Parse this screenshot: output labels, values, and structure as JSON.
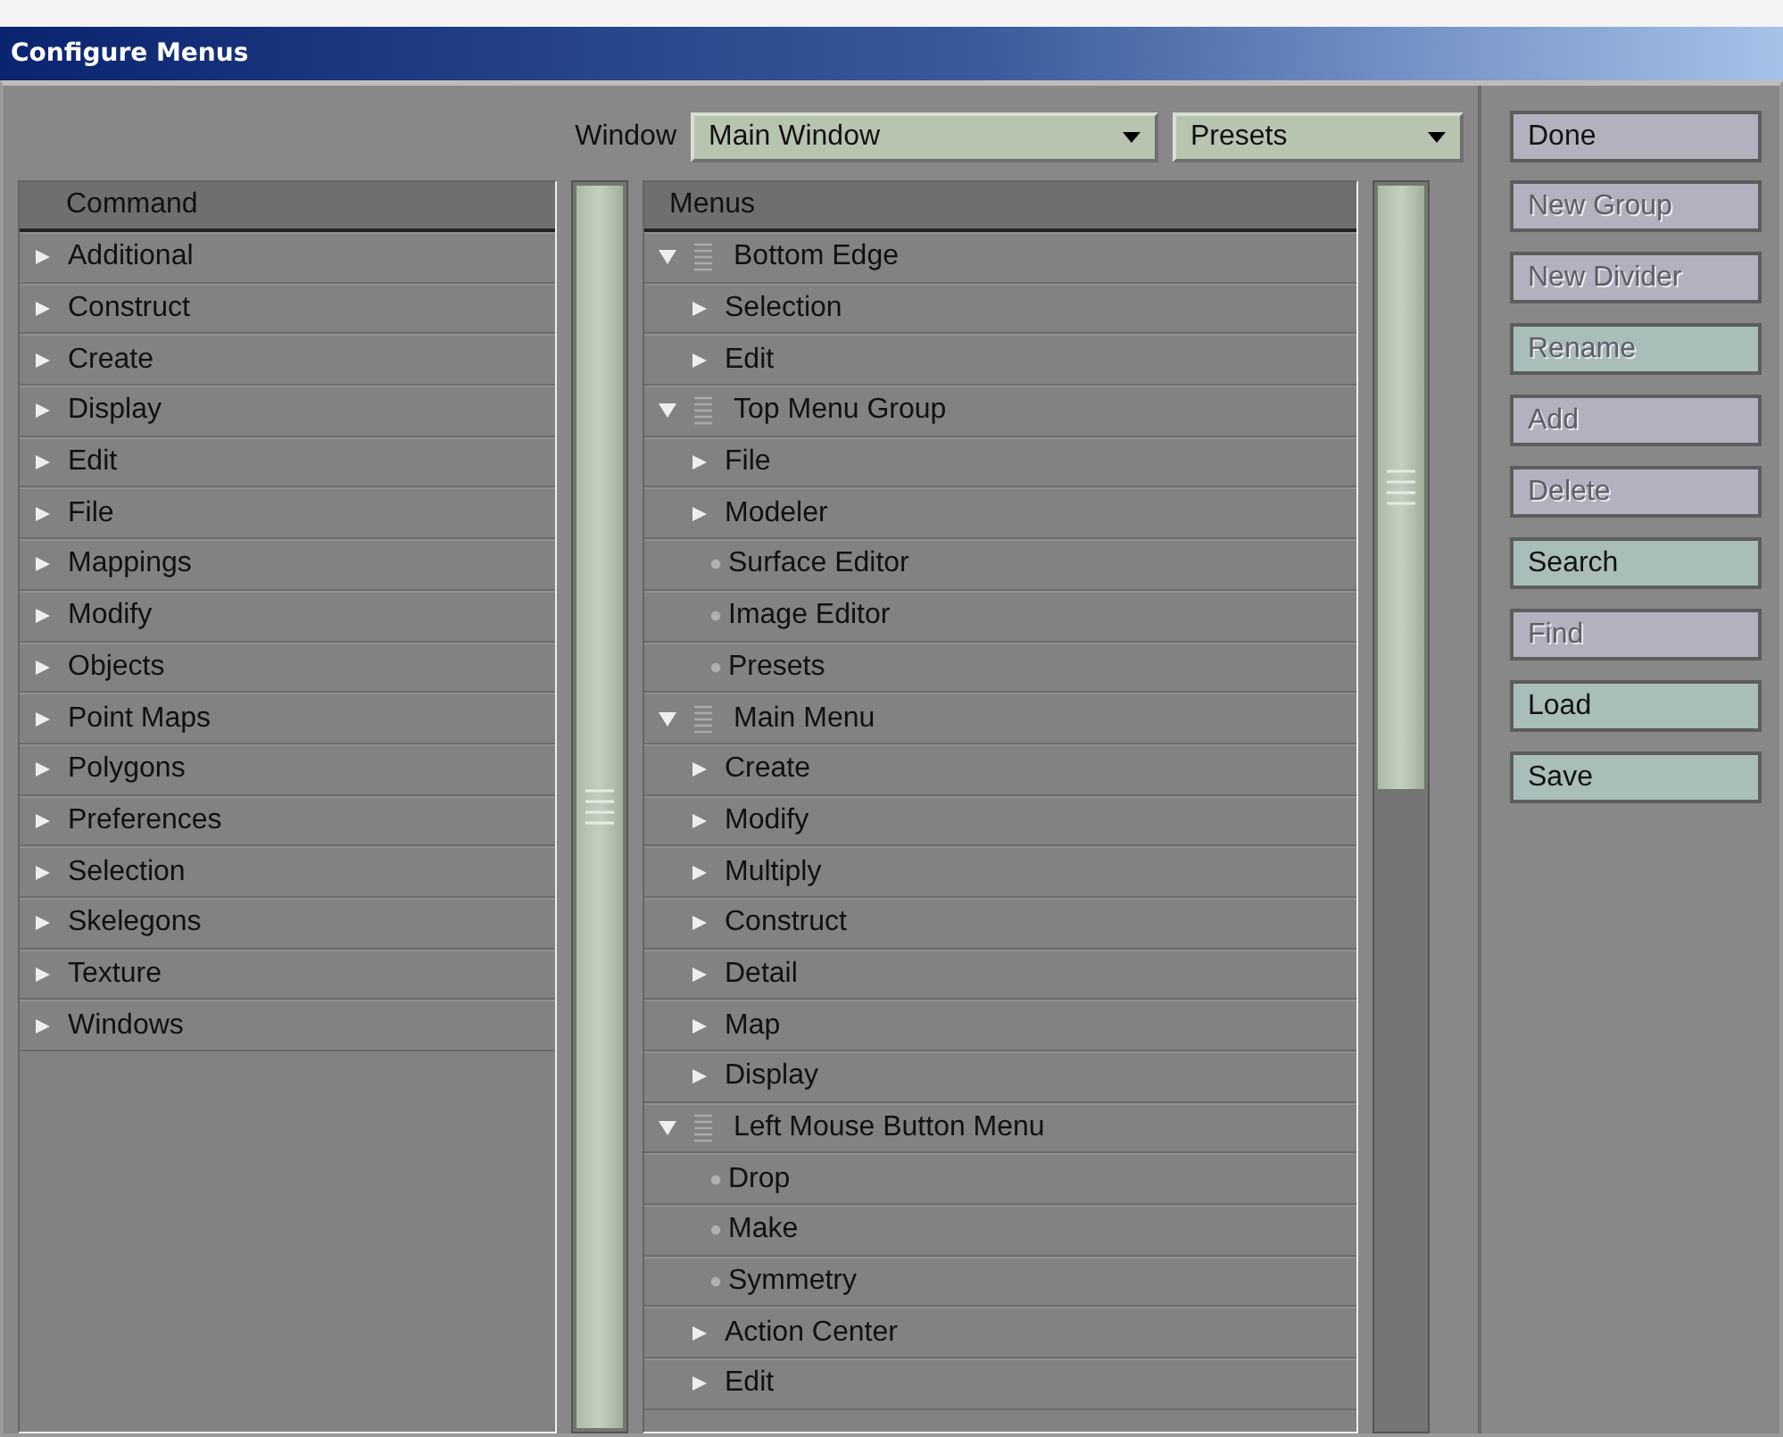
{
  "window": {
    "title": "Configure Menus"
  },
  "window_selector": {
    "label": "Window",
    "value": "Main Window"
  },
  "presets": {
    "value": "Presets"
  },
  "command_list": {
    "header": "Command",
    "items": [
      {
        "label": "Additional",
        "kind": "submenu"
      },
      {
        "label": "Construct",
        "kind": "submenu"
      },
      {
        "label": "Create",
        "kind": "submenu"
      },
      {
        "label": "Display",
        "kind": "submenu"
      },
      {
        "label": "Edit",
        "kind": "submenu"
      },
      {
        "label": "File",
        "kind": "submenu"
      },
      {
        "label": "Mappings",
        "kind": "submenu"
      },
      {
        "label": "Modify",
        "kind": "submenu"
      },
      {
        "label": "Objects",
        "kind": "submenu"
      },
      {
        "label": "Point Maps",
        "kind": "submenu"
      },
      {
        "label": "Polygons",
        "kind": "submenu"
      },
      {
        "label": "Preferences",
        "kind": "submenu"
      },
      {
        "label": "Selection",
        "kind": "submenu"
      },
      {
        "label": "Skelegons",
        "kind": "submenu"
      },
      {
        "label": "Texture",
        "kind": "submenu"
      },
      {
        "label": "Windows",
        "kind": "submenu"
      }
    ]
  },
  "menus_tree": {
    "header": "Menus",
    "items": [
      {
        "label": "Bottom Edge",
        "kind": "group",
        "expanded": true,
        "children": [
          {
            "label": "Selection",
            "kind": "submenu"
          },
          {
            "label": "Edit",
            "kind": "submenu"
          }
        ]
      },
      {
        "label": "Top Menu Group",
        "kind": "group",
        "expanded": true,
        "children": [
          {
            "label": "File",
            "kind": "submenu"
          },
          {
            "label": "Modeler",
            "kind": "submenu"
          },
          {
            "label": "Surface Editor",
            "kind": "command"
          },
          {
            "label": "Image Editor",
            "kind": "command"
          },
          {
            "label": "Presets",
            "kind": "command"
          }
        ]
      },
      {
        "label": "Main Menu",
        "kind": "group",
        "expanded": true,
        "children": [
          {
            "label": "Create",
            "kind": "submenu"
          },
          {
            "label": "Modify",
            "kind": "submenu"
          },
          {
            "label": "Multiply",
            "kind": "submenu"
          },
          {
            "label": "Construct",
            "kind": "submenu"
          },
          {
            "label": "Detail",
            "kind": "submenu"
          },
          {
            "label": "Map",
            "kind": "submenu"
          },
          {
            "label": "Display",
            "kind": "submenu"
          }
        ]
      },
      {
        "label": "Left Mouse Button Menu",
        "kind": "group",
        "expanded": true,
        "children": [
          {
            "label": "Drop",
            "kind": "command"
          },
          {
            "label": "Make",
            "kind": "command"
          },
          {
            "label": "Symmetry",
            "kind": "command"
          },
          {
            "label": "Action Center",
            "kind": "submenu"
          },
          {
            "label": "Edit",
            "kind": "submenu"
          }
        ]
      }
    ]
  },
  "buttons": [
    {
      "label": "Done",
      "disabled": false,
      "color": "#b3b1c0"
    },
    {
      "label": "New Group",
      "disabled": true,
      "color": "#b3b1c0"
    },
    {
      "label": "New Divider",
      "disabled": true,
      "color": "#b3b1c0"
    },
    {
      "label": "Rename",
      "disabled": true,
      "color": "#a9bdb9"
    },
    {
      "label": "Add",
      "disabled": true,
      "color": "#b3b1c0"
    },
    {
      "label": "Delete",
      "disabled": true,
      "color": "#b3b1c0"
    },
    {
      "label": "Search",
      "disabled": false,
      "color": "#a9bdb9"
    },
    {
      "label": "Find",
      "disabled": true,
      "color": "#b3b1c0"
    },
    {
      "label": "Load",
      "disabled": false,
      "color": "#a9bdb9"
    },
    {
      "label": "Save",
      "disabled": false,
      "color": "#a9bdb9"
    }
  ]
}
